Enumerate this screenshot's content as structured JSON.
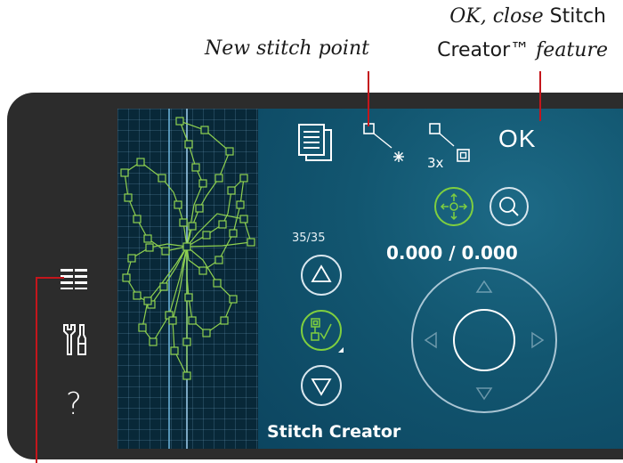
{
  "annotations": {
    "new_stitch_point": "New stitch point",
    "ok_close_line1_italic": "OK, close",
    "ok_close_line1_plain": " Stitch",
    "ok_close_line2_plain": "Creator™",
    "ok_close_line2_italic": " feature"
  },
  "sidebar": {
    "items": [
      {
        "icon": "menu-list-icon"
      },
      {
        "icon": "tools-icon"
      },
      {
        "icon": "help-icon",
        "glyph": "?"
      }
    ]
  },
  "screen": {
    "ok_label": "OK",
    "repeat_label": "3x",
    "counter": "35/35",
    "coordinates": "0.000 / 0.000",
    "title": "Stitch Creator"
  },
  "colors": {
    "stitch": "#8fd14f",
    "callout": "#c4161c",
    "accent_green": "#7fcf3f"
  }
}
